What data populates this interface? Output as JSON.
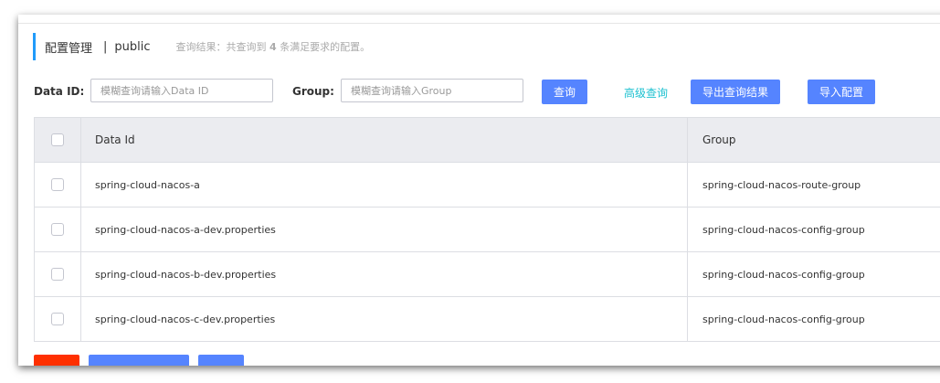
{
  "header": {
    "title": "配置管理",
    "separator": "|",
    "namespace": "public",
    "result_prefix": "查询结果：共查询到",
    "result_count": "4",
    "result_suffix": "条满足要求的配置。"
  },
  "search": {
    "dataid_label": "Data ID:",
    "dataid_placeholder": "模糊查询请输入Data ID",
    "group_label": "Group:",
    "group_placeholder": "模糊查询请输入Group",
    "query_button": "查询",
    "advanced_link": "高级查询",
    "export_button": "导出查询结果",
    "import_button": "导入配置"
  },
  "table": {
    "columns": [
      "Data Id",
      "Group"
    ],
    "rows": [
      {
        "data_id": "spring-cloud-nacos-a",
        "group": "spring-cloud-nacos-route-group"
      },
      {
        "data_id": "spring-cloud-nacos-a-dev.properties",
        "group": "spring-cloud-nacos-config-group"
      },
      {
        "data_id": "spring-cloud-nacos-b-dev.properties",
        "group": "spring-cloud-nacos-config-group"
      },
      {
        "data_id": "spring-cloud-nacos-c-dev.properties",
        "group": "spring-cloud-nacos-config-group"
      }
    ]
  },
  "colors": {
    "accent": "#209bfa",
    "primary_button": "#5584ff",
    "link": "#1dc1d0",
    "danger_button": "#ff3000",
    "table_header": "#ebecf0"
  }
}
